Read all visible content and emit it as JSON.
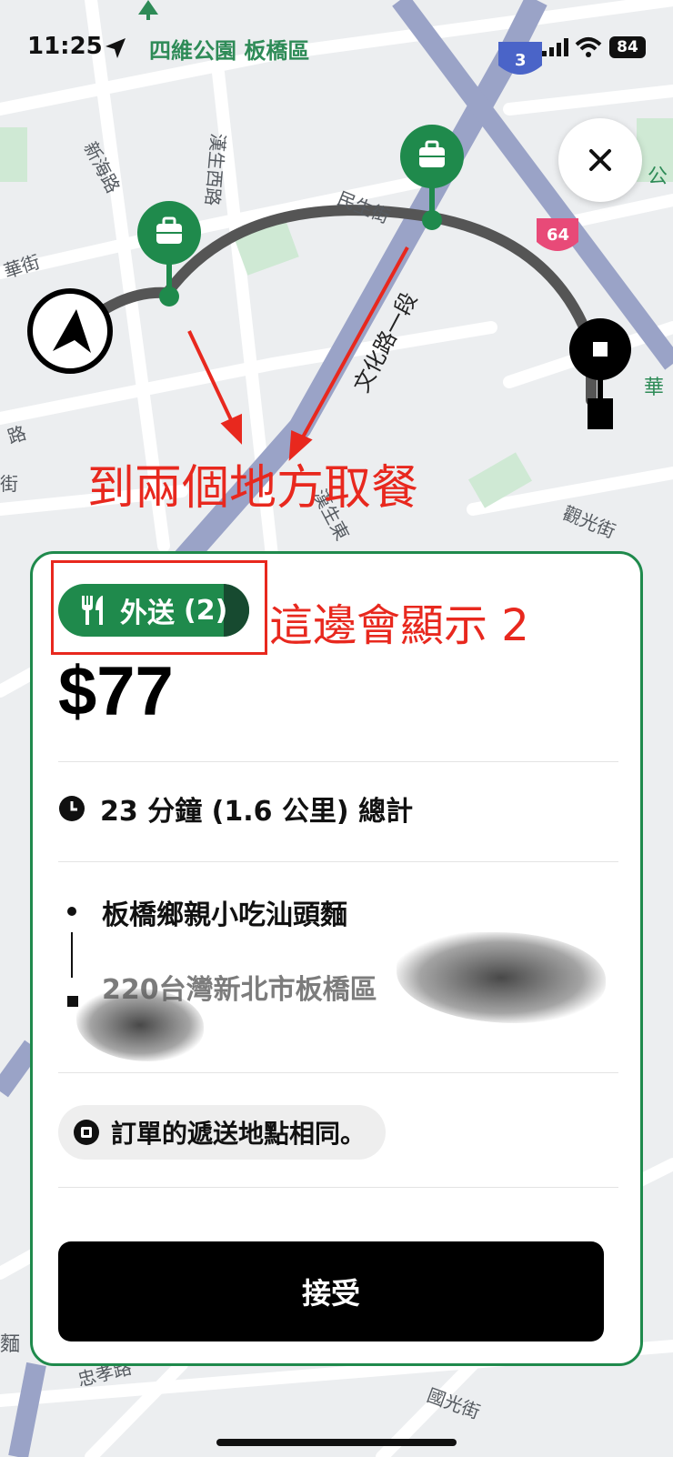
{
  "status_bar": {
    "time": "11:25",
    "location_name": "四維公園 板橋區",
    "battery": "84"
  },
  "map": {
    "labels": {
      "xinhai_road": "新海路",
      "hansheng_w_road": "漢生西路",
      "minsheng_street": "民生街",
      "wenhua_road": "文化路一段",
      "hua_street": "華街",
      "road_left": "路",
      "street_left": "街",
      "hansheng_e": "漢生東",
      "guanguang_street": "觀光街",
      "zhongxiao_road": "忠孝路",
      "guoguang_street": "國光街",
      "hua_right": "華",
      "park_right": "公",
      "noodle_left": "麵",
      "route_3": "3",
      "route_64": "64"
    }
  },
  "annotations": {
    "two_pickups": "到兩個地方取餐",
    "shows_two": "這邊會顯示 2"
  },
  "offer": {
    "badge_label": "外送",
    "badge_count": "(2)",
    "price": "$77",
    "trip_summary": "23 分鐘 (1.6 公里) 總計",
    "pickup_name": "板橋鄉親小吃汕頭麵",
    "dropoff_address": "220台灣新北市板橋區",
    "same_location_note": "訂單的遞送地點相同。",
    "accept_label": "接受"
  },
  "colors": {
    "brand_green": "#1f8a4c",
    "annotation_red": "#e8281e",
    "route_gray": "#555555"
  }
}
